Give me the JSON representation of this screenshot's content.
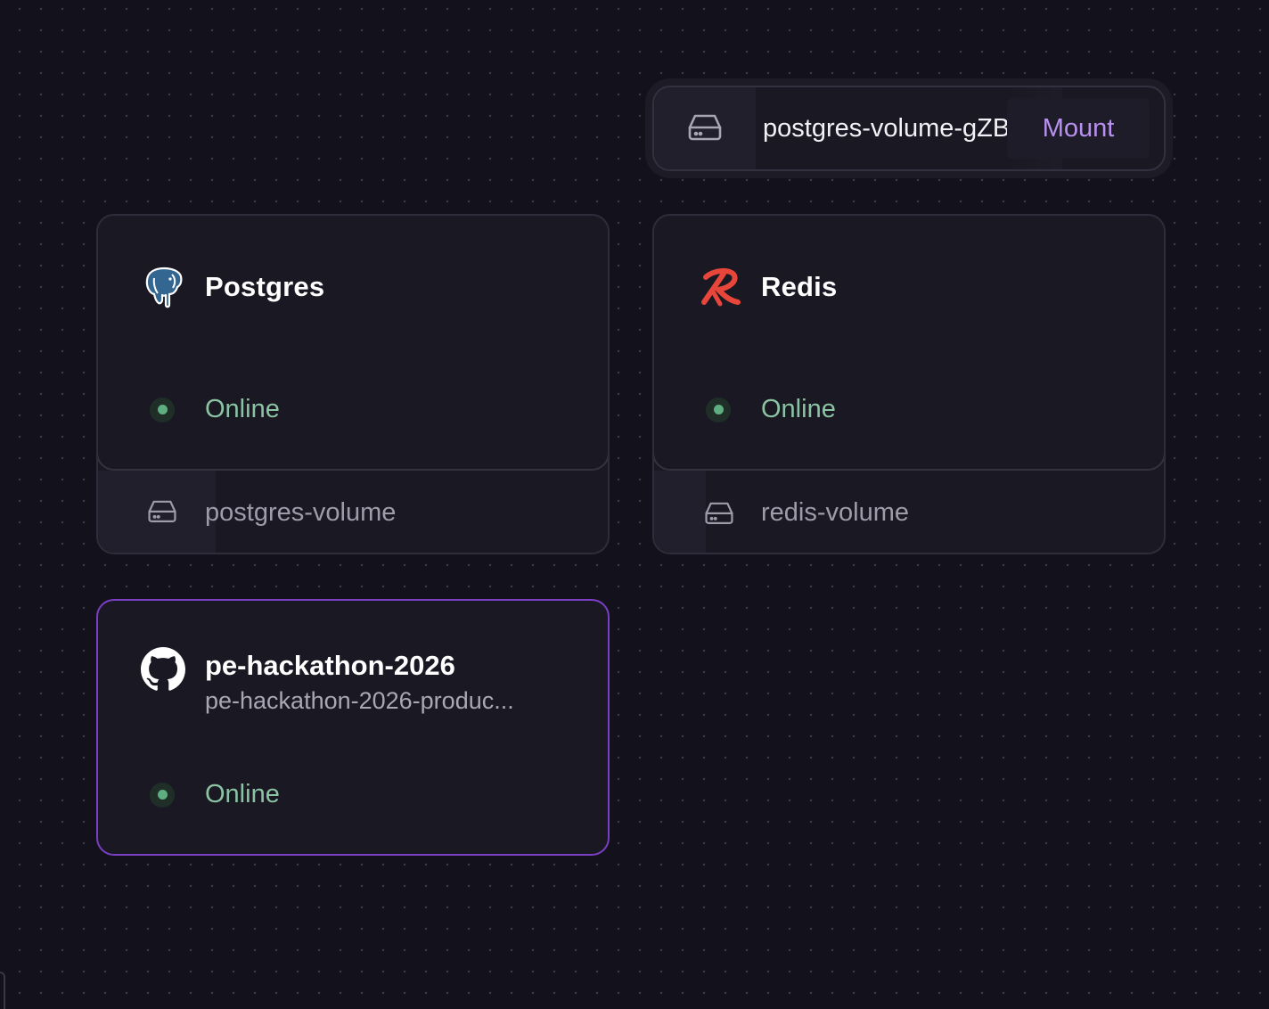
{
  "floating_volume": {
    "name": "postgres-volume-gZBf",
    "action_label": "Mount",
    "icon": "hard-drive-icon"
  },
  "services": [
    {
      "title": "Postgres",
      "icon": "postgres-elephant-icon",
      "status": "Online",
      "volume": "postgres-volume"
    },
    {
      "title": "Redis",
      "icon": "redis-icon",
      "status": "Online",
      "volume": "redis-volume"
    }
  ],
  "repo": {
    "title": "pe-hackathon-2026",
    "subtitle": "pe-hackathon-2026-produc...",
    "icon": "github-icon",
    "status": "Online"
  },
  "colors": {
    "background": "#13111c",
    "card": "#191823",
    "online": "#8ac4a2",
    "accent_border": "#7a3fc2",
    "mount": "#b890f0",
    "redis": "#e8463a"
  }
}
